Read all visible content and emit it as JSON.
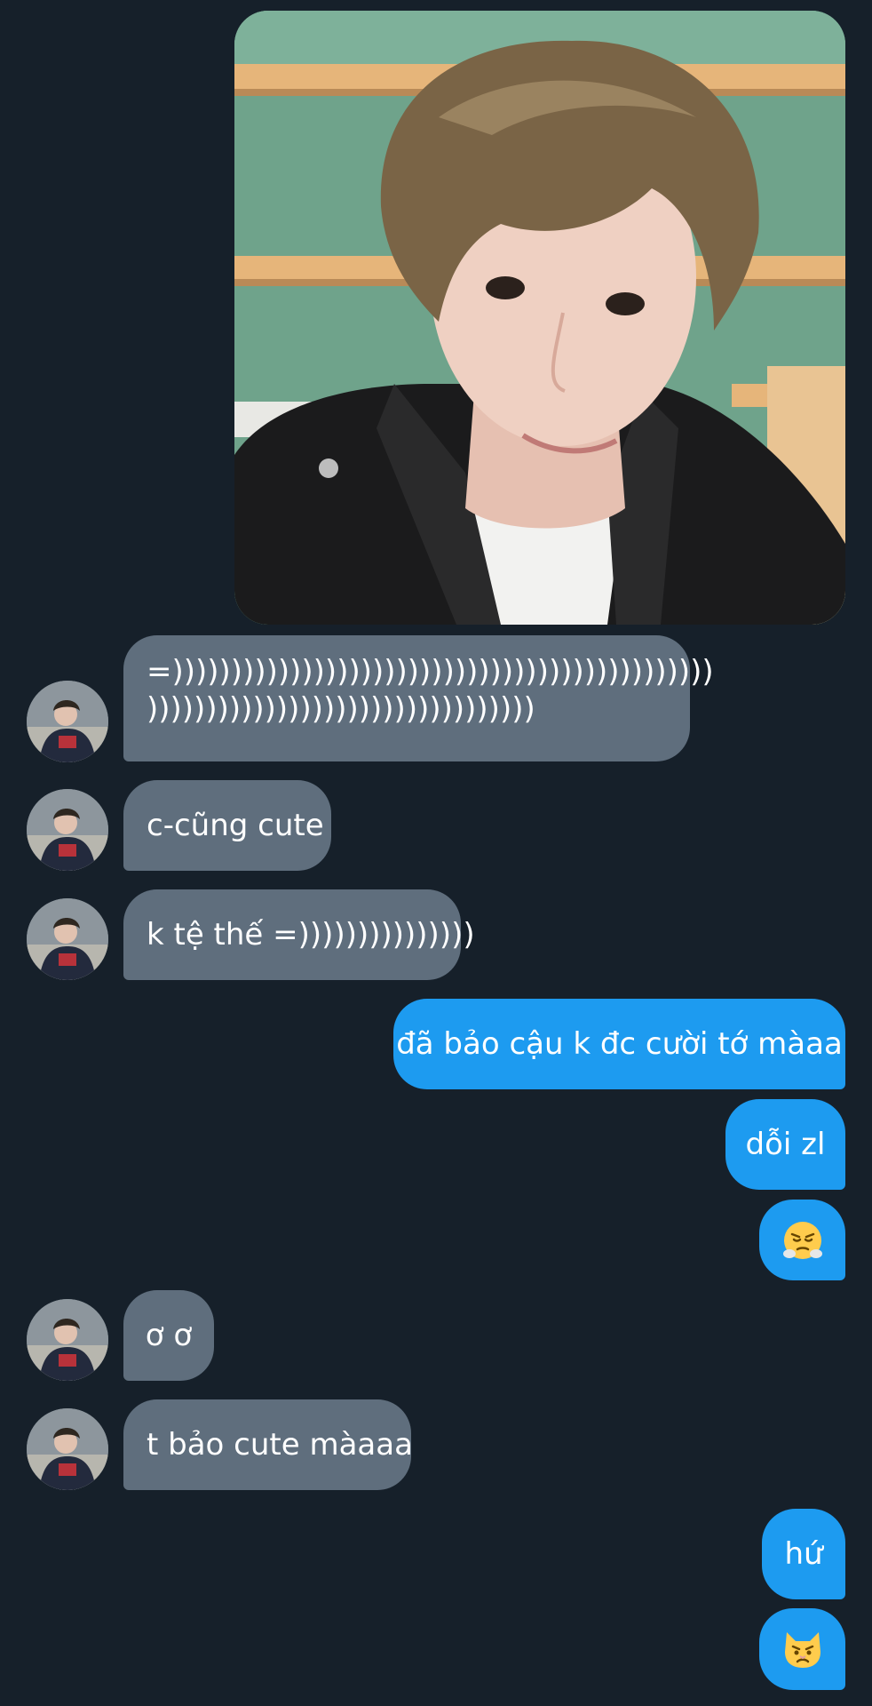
{
  "conversation": {
    "photo": {
      "description_icon": "selfie-photo",
      "colors": {
        "wall": "#6fa38b",
        "stripe": "#e6b57a",
        "jacket": "#1b1b1c",
        "shirt": "#f2f2f0",
        "skin": "#efd0c2",
        "hair": "#7a6446"
      }
    },
    "messages": [
      {
        "id": "m1",
        "side": "in",
        "lines": [
          "=))))))))))))))))))))))))))))))))))))))))))))))",
          ")))))))))))))))))))))))))))))))))"
        ]
      },
      {
        "id": "m2",
        "side": "in",
        "text": "c-cũng cute"
      },
      {
        "id": "m3",
        "side": "in",
        "text": "k tệ thế =)))))))))))))))"
      },
      {
        "id": "m4",
        "side": "out",
        "text": "đã bảo cậu k đc cười tớ màaa"
      },
      {
        "id": "m5",
        "side": "out",
        "text": "dỗi zl"
      },
      {
        "id": "m6",
        "side": "out",
        "emoji": "face-with-steam-from-nose-icon"
      },
      {
        "id": "m7",
        "side": "in",
        "text": "ơ ơ"
      },
      {
        "id": "m8",
        "side": "in",
        "text": "t bảo cute màaaa"
      },
      {
        "id": "m9",
        "side": "out",
        "text": "hứ"
      },
      {
        "id": "m10",
        "side": "out",
        "emoji": "pouting-cat-face-icon"
      }
    ]
  },
  "theme": {
    "background": "#16202a",
    "incoming_bubble": "#5f6e7d",
    "outgoing_bubble": "#1d9bf0",
    "text": "#ffffff"
  }
}
